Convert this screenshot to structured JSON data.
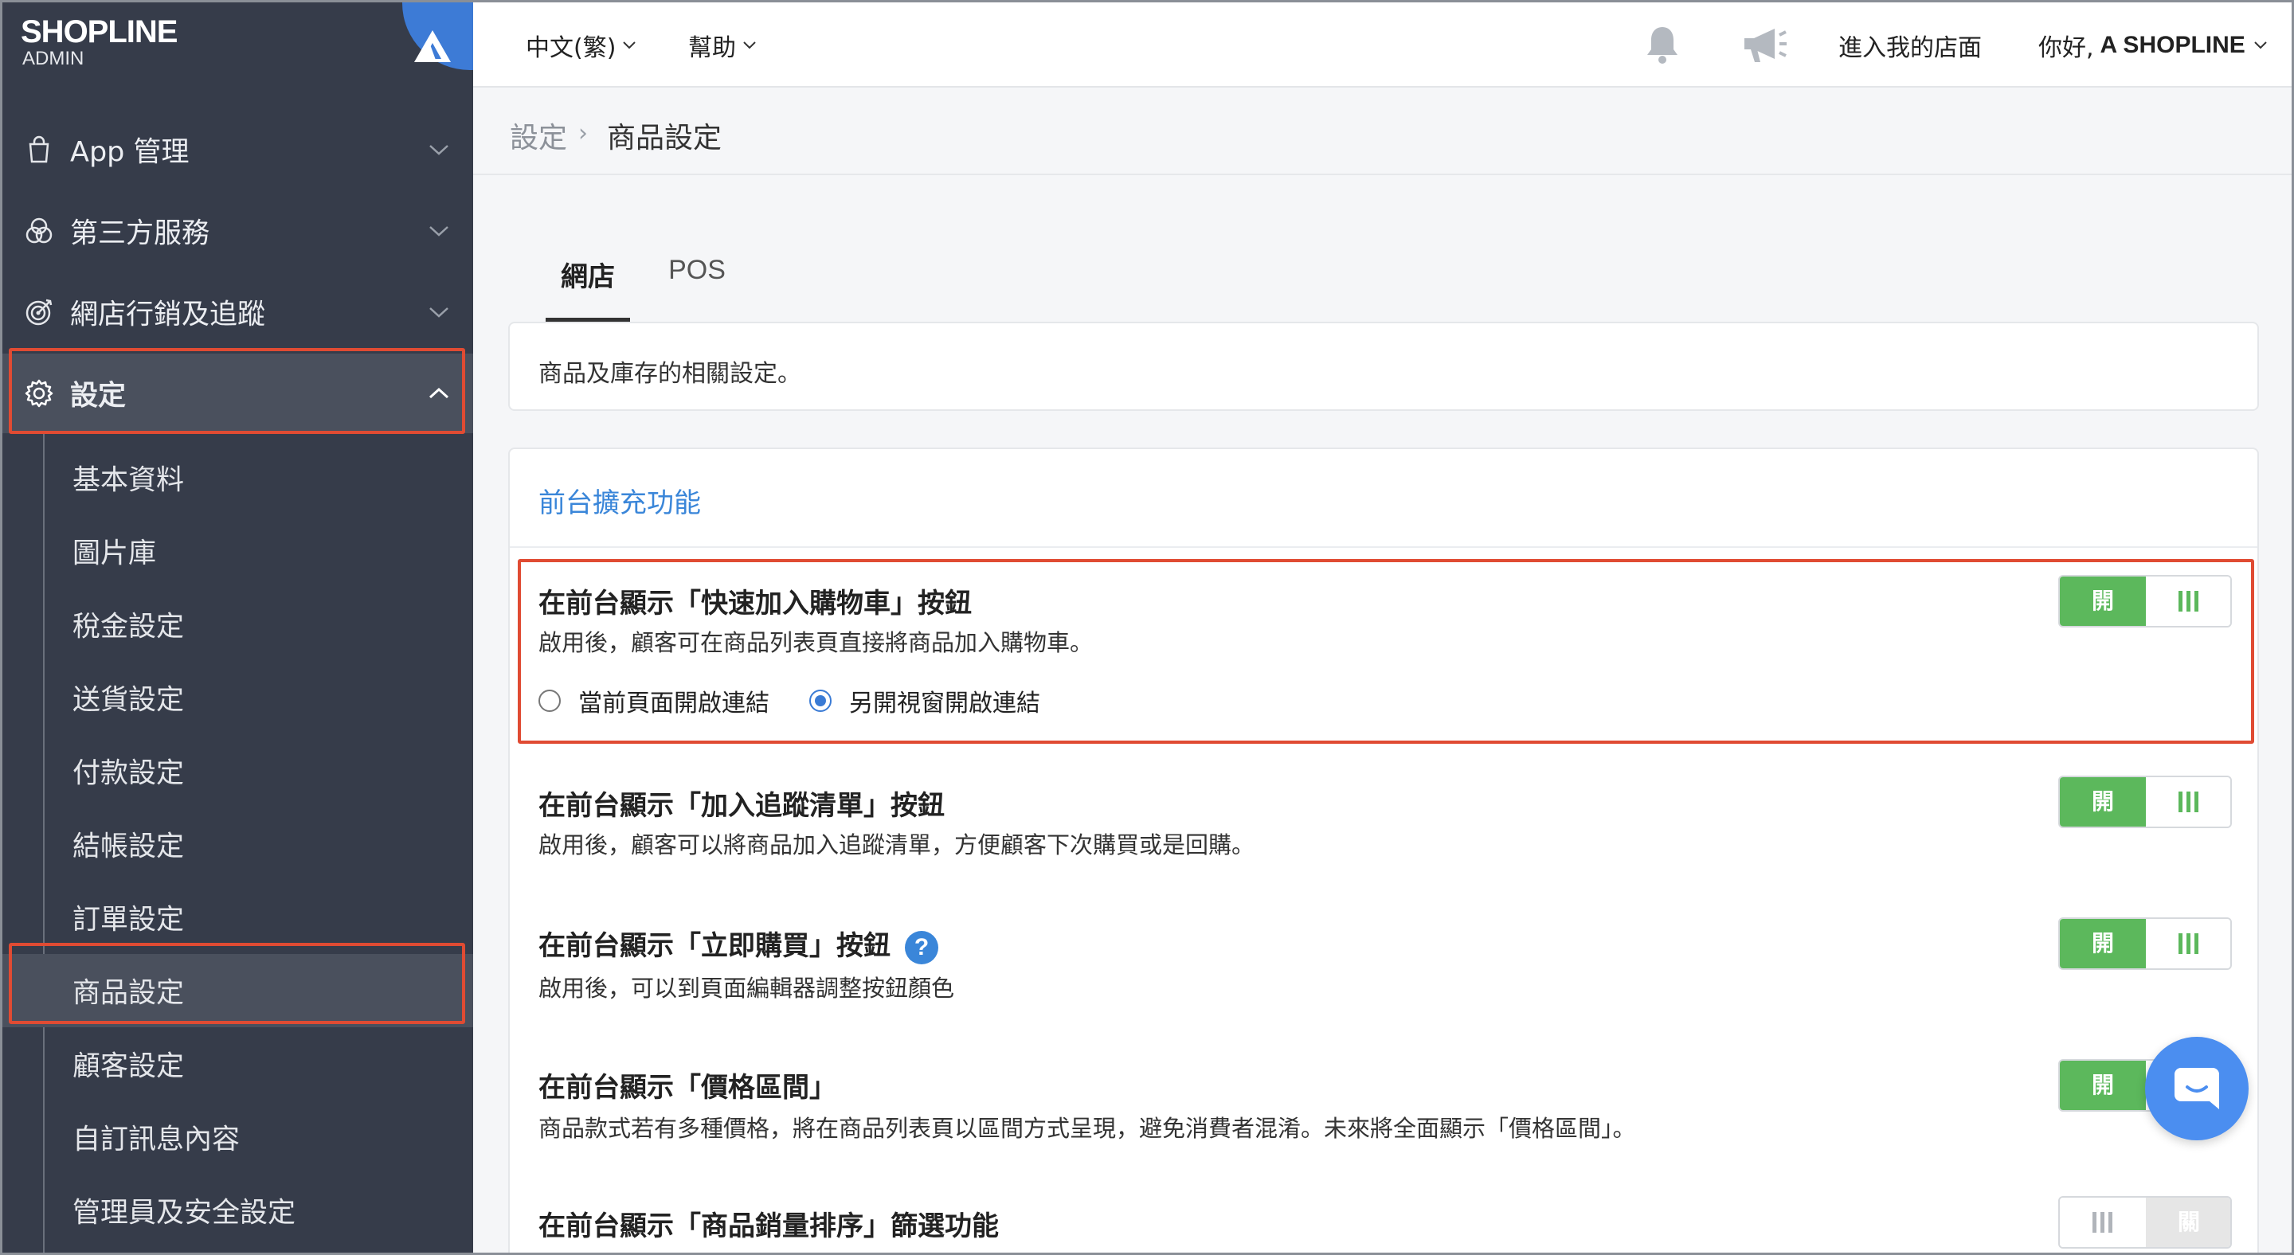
{
  "brand": {
    "name": "SHOPLINE",
    "sub": "ADMIN"
  },
  "sidebar": {
    "sections": [
      {
        "label": "App 管理",
        "icon": "shopping-bag-icon"
      },
      {
        "label": "第三方服務",
        "icon": "venn-circles-icon"
      },
      {
        "label": "網店行銷及追蹤",
        "icon": "target-icon"
      },
      {
        "label": "設定",
        "icon": "gear-icon",
        "expanded": true
      }
    ],
    "sub_items": [
      {
        "label": "基本資料"
      },
      {
        "label": "圖片庫"
      },
      {
        "label": "稅金設定"
      },
      {
        "label": "送貨設定"
      },
      {
        "label": "付款設定"
      },
      {
        "label": "結帳設定"
      },
      {
        "label": "訂單設定"
      },
      {
        "label": "商品設定",
        "active": true
      },
      {
        "label": "顧客設定"
      },
      {
        "label": "自訂訊息內容"
      },
      {
        "label": "管理員及安全設定"
      }
    ]
  },
  "topbar": {
    "language": "中文(繁)",
    "help": "幫助",
    "store_link": "進入我的店面",
    "greeting_prefix": "你好,",
    "greeting_name": "A SHOPLINE"
  },
  "breadcrumb": {
    "parent": "設定",
    "current": "商品設定"
  },
  "tabs": [
    {
      "label": "網店",
      "active": true
    },
    {
      "label": "POS",
      "active": false
    }
  ],
  "description": "商品及庫存的相關設定。",
  "section": {
    "title": "前台擴充功能",
    "settings": [
      {
        "title": "在前台顯示「快速加入購物車」按鈕",
        "desc": "啟用後，顧客可在商品列表頁直接將商品加入購物車。",
        "toggle_label": "開",
        "enabled": true,
        "radio_options": [
          {
            "label": "當前頁面開啟連結",
            "checked": false
          },
          {
            "label": "另開視窗開啟連結",
            "checked": true
          }
        ]
      },
      {
        "title": "在前台顯示「加入追蹤清單」按鈕",
        "desc": "啟用後，顧客可以將商品加入追蹤清單，方便顧客下次購買或是回購。",
        "toggle_label": "開",
        "enabled": true
      },
      {
        "title": "在前台顯示「立即購買」按鈕",
        "desc": "啟用後，可以到頁面編輯器調整按鈕顏色",
        "toggle_label": "開",
        "enabled": true,
        "help": "?"
      },
      {
        "title": "在前台顯示「價格區間」",
        "desc": "商品款式若有多種價格，將在商品列表頁以區間方式呈現，避免消費者混淆。未來將全面顯示「價格區間」。",
        "toggle_label": "開",
        "enabled": true
      },
      {
        "title": "在前台顯示「商品銷量排序」篩選功能",
        "desc": "",
        "toggle_label": "關",
        "enabled": false
      }
    ]
  },
  "colors": {
    "sidebar_bg": "#363c4a",
    "accent_blue": "#3a86d9",
    "toggle_green": "#5cb85c",
    "highlight_red": "#e04b33"
  }
}
